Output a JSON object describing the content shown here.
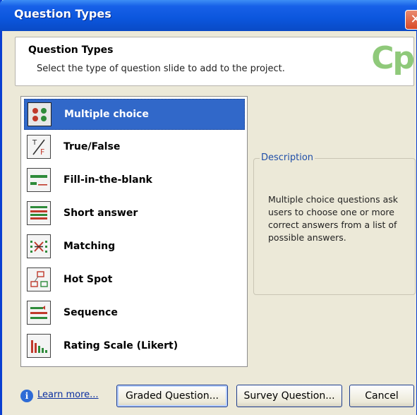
{
  "window": {
    "title": "Question Types",
    "close_symbol": "✕"
  },
  "header": {
    "title": "Question Types",
    "subtitle": "Select the type of question slide to add to the project.",
    "logo_text": "Cp"
  },
  "question_types": [
    {
      "label": "Multiple choice",
      "icon": "multiple-choice-icon",
      "selected": true
    },
    {
      "label": "True/False",
      "icon": "true-false-icon",
      "selected": false
    },
    {
      "label": "Fill-in-the-blank",
      "icon": "fill-in-the-blank-icon",
      "selected": false
    },
    {
      "label": "Short answer",
      "icon": "short-answer-icon",
      "selected": false
    },
    {
      "label": "Matching",
      "icon": "matching-icon",
      "selected": false
    },
    {
      "label": "Hot Spot",
      "icon": "hot-spot-icon",
      "selected": false
    },
    {
      "label": "Sequence",
      "icon": "sequence-icon",
      "selected": false
    },
    {
      "label": "Rating Scale (Likert)",
      "icon": "rating-scale-icon",
      "selected": false
    }
  ],
  "description": {
    "legend": "Description",
    "text": "Multiple choice questions ask users to choose one or more correct answers from a list of possible answers."
  },
  "footer": {
    "info_symbol": "i",
    "learn_more": "Learn more...",
    "graded_button": "Graded Question...",
    "survey_button": "Survey Question...",
    "cancel_button": "Cancel"
  },
  "colors": {
    "titlebar": "#0b56dd",
    "selection": "#3168c9",
    "logo": "#8fc97a",
    "dialog_bg": "#ece9d8"
  }
}
